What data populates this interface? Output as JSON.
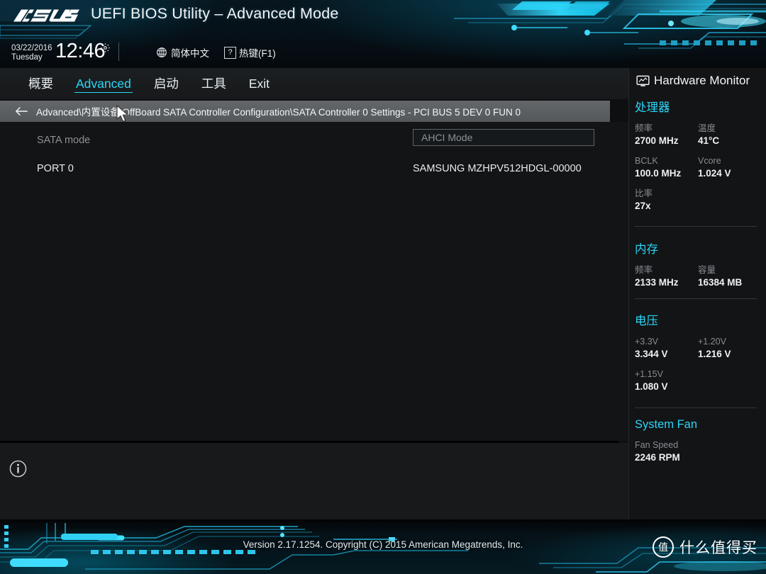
{
  "header": {
    "brand": "ASUS",
    "title": "UEFI BIOS Utility – Advanced Mode",
    "date": "03/22/2016",
    "weekday": "Tuesday",
    "time": "12:46",
    "gear_icon": "gear-icon",
    "language_icon": "globe-icon",
    "language": "简体中文",
    "hotkey_icon": "question-mark-icon",
    "hotkey": "热键(F1)"
  },
  "tabs": [
    {
      "label": "概要",
      "active": false
    },
    {
      "label": "Advanced",
      "active": true
    },
    {
      "label": "启动",
      "active": false
    },
    {
      "label": "工具",
      "active": false
    },
    {
      "label": "Exit",
      "active": false
    }
  ],
  "breadcrumb": {
    "back_icon": "back-arrow-icon",
    "path": "Advanced\\内置设备\\OffBoard SATA Controller Configuration\\SATA Controller 0 Settings - PCI BUS 5 DEV 0 FUN 0"
  },
  "settings": [
    {
      "label": "SATA mode",
      "value": "AHCI Mode",
      "type": "dropdown",
      "disabled": true
    },
    {
      "label": "PORT 0",
      "value": "SAMSUNG MZHPV512HDGL-00000",
      "type": "text",
      "disabled": false
    }
  ],
  "help": {
    "info_icon": "info-icon"
  },
  "hardware_monitor": {
    "title": "Hardware Monitor",
    "title_icon": "monitor-icon",
    "sections": [
      {
        "heading": "处理器",
        "items": [
          {
            "key": "频率",
            "value": "2700 MHz"
          },
          {
            "key": "温度",
            "value": "41°C"
          },
          {
            "key": "BCLK",
            "value": "100.0 MHz"
          },
          {
            "key": "Vcore",
            "value": "1.024 V"
          },
          {
            "key": "比率",
            "value": "27x"
          }
        ]
      },
      {
        "heading": "内存",
        "items": [
          {
            "key": "频率",
            "value": "2133 MHz"
          },
          {
            "key": "容量",
            "value": "16384 MB"
          }
        ]
      },
      {
        "heading": "电压",
        "items": [
          {
            "key": "+3.3V",
            "value": "3.344 V"
          },
          {
            "key": "+1.20V",
            "value": "1.216 V"
          },
          {
            "key": "+1.15V",
            "value": "1.080 V"
          }
        ]
      },
      {
        "heading": "System Fan",
        "items": [
          {
            "key": "Fan Speed",
            "value": "2246 RPM"
          }
        ]
      }
    ]
  },
  "footer": {
    "version_text": "Version 2.17.1254. Copyright (C) 2015 American Megatrends, Inc.",
    "watermark_mark": "值",
    "watermark_text": "什么值得买"
  },
  "colors": {
    "accent_cyan": "#2bd6f5",
    "panel_bg": "#121416",
    "breadcrumb_bg": "#5a5e61",
    "dim_text": "#8b9195"
  }
}
